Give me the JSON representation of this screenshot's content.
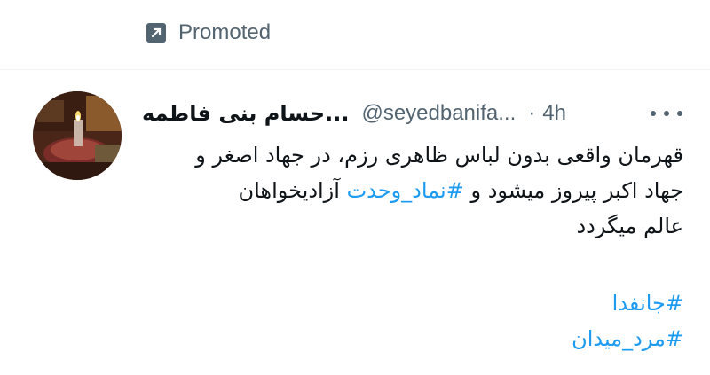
{
  "promoted": {
    "label": "Promoted",
    "icon": "promoted-arrow-icon"
  },
  "tweet": {
    "author_name": "...حسام بنی فاطمه",
    "handle": "@seyedbanifa...",
    "separator": "·",
    "time": "4h",
    "more_icon": "more-dots-icon",
    "text": {
      "line1": "قهرمان واقعی بدون لباس ظاهری رزم، در جهاد اصغر و",
      "line2_prefix": "جهاد اکبر پیروز میشود و ",
      "line2_hashtag": "#نماد_وحدت",
      "line2_suffix": " آزادیخواهان",
      "line3": "عالم میگردد"
    },
    "hashtags": [
      "#جانفدا",
      "#مرد_میدان"
    ]
  },
  "colors": {
    "link": "#1d9bf0",
    "secondary": "#536471",
    "text": "#0f1419"
  }
}
